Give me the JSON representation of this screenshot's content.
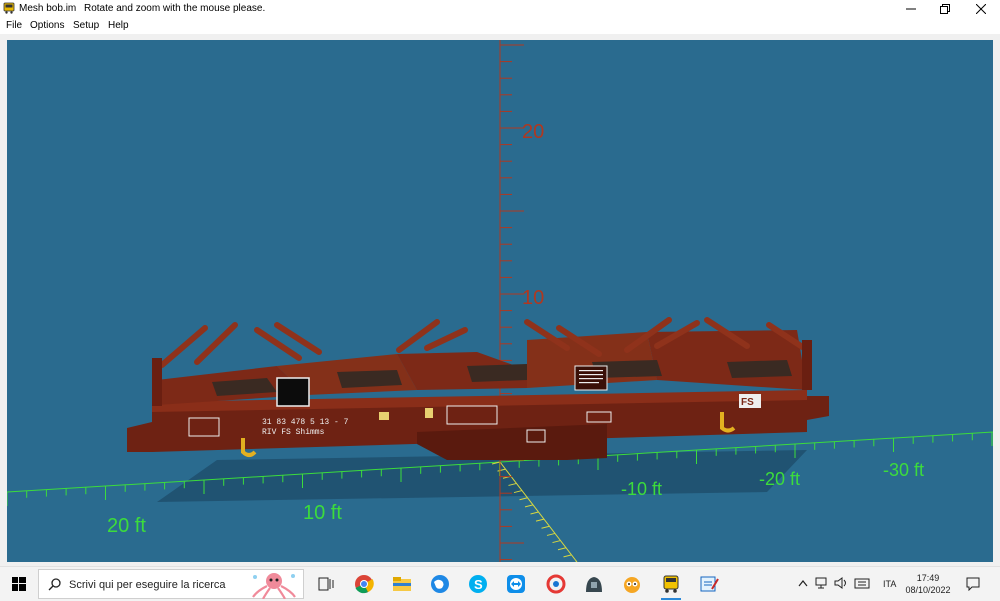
{
  "window": {
    "title": "Mesh bob.im",
    "hint": "Rotate and zoom with the mouse please."
  },
  "menu": [
    "File",
    "Options",
    "Setup",
    "Help"
  ],
  "viewport": {
    "background": "#2a6b8f",
    "vertical_axis_labels": [
      "20",
      "10"
    ],
    "ground_axis_labels": [
      "20 ft",
      "10 ft",
      "-10 ft",
      "-20 ft",
      "-30 ft"
    ],
    "axis_color": "#3cdc3c",
    "model": {
      "body_color": "#7a2716",
      "panel_text_1": "31 83 478 5 13 - 7",
      "panel_text_2": "RIV FS Shimms"
    }
  },
  "taskbar": {
    "search_placeholder": "Scrivi qui per eseguire la ricerca",
    "apps": [
      "task-view-icon",
      "chrome-icon",
      "file-explorer-icon",
      "app-blue-globe-icon",
      "skype-icon",
      "teamviewer-icon",
      "app-red-icon",
      "app-dark-icon",
      "app-eye-icon",
      "train-app-icon",
      "app-editor-icon"
    ],
    "language": "ITA",
    "time": "17:49",
    "date": "08/10/2022"
  }
}
